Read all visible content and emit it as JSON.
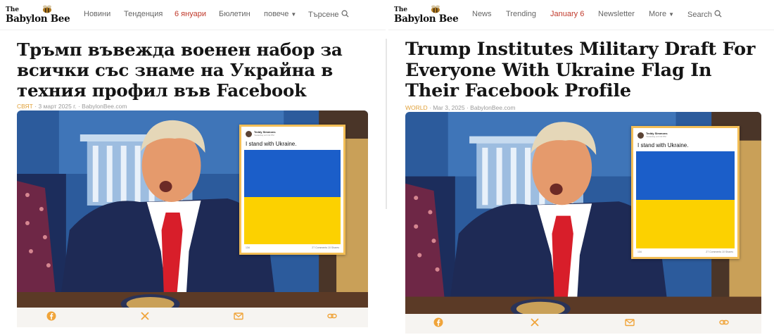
{
  "brand": {
    "logo_small": "The",
    "logo_name": "Babylon Bee",
    "accent_color": "#c0392b",
    "category_color": "#e0a13a",
    "frame_color": "#f3be56"
  },
  "left": {
    "language": "bg",
    "nav": {
      "news": "Новини",
      "trending": "Тенденция",
      "date": "6 януари",
      "newsletter": "Бюлетин",
      "more": "повече",
      "search": "Търсене"
    },
    "headline": "Тръмп въвежда военен набор за всички със знаме на Украйна в техния профил във Facebook",
    "meta": {
      "category": "СВЯТ",
      "date": "3 март 2025 г.",
      "source": "BabylonBee.com"
    }
  },
  "right": {
    "language": "en",
    "nav": {
      "news": "News",
      "trending": "Trending",
      "date": "January 6",
      "newsletter": "Newsletter",
      "more": "More",
      "search": "Search"
    },
    "headline": "Trump Institutes Military Draft For Everyone With Ukraine Flag In Their Facebook Profile",
    "meta": {
      "category": "WORLD",
      "date": "Mar 3, 2025",
      "source": "BabylonBee.com"
    }
  },
  "facebook_post": {
    "author": "Teddy Simmons",
    "subline": "Yesterday at 3:42 PM",
    "text": "I stand with Ukraine.",
    "reactions": "134",
    "comments": "27 Comments 10 Shares",
    "flag_top_color": "#1b5ec9",
    "flag_bottom_color": "#fcd100"
  },
  "share_icons": [
    "facebook-icon",
    "x-icon",
    "email-icon",
    "link-icon"
  ]
}
